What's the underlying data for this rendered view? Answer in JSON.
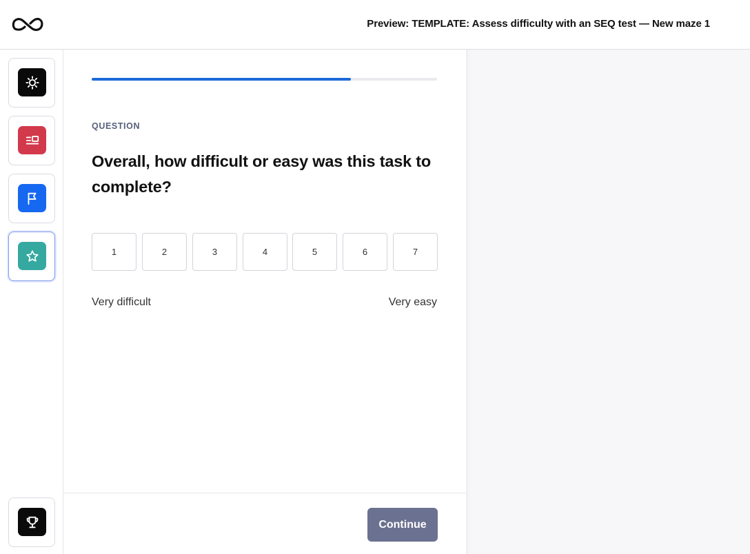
{
  "header": {
    "logo_icon": "maze-logo-icon",
    "title": "Preview: TEMPLATE: Assess difficulty with an SEQ test — New maze 1"
  },
  "sidebar": {
    "blocks": [
      {
        "icon": "gear-icon",
        "color": "#0a0a0a",
        "active": false
      },
      {
        "icon": "context-screen-icon",
        "color": "#d2394b",
        "active": false
      },
      {
        "icon": "flag-icon",
        "color": "#1668f0",
        "active": false
      },
      {
        "icon": "star-icon",
        "color": "#35a99f",
        "active": true
      }
    ],
    "thank_you_block": {
      "icon": "trophy-icon",
      "color": "#0a0a0a"
    }
  },
  "main": {
    "progress": 0.75,
    "progress_color": "#1b6ad9",
    "label": "QUESTION",
    "question": "Overall, how difficult or easy was this task to complete?",
    "scale_options": [
      "1",
      "2",
      "3",
      "4",
      "5",
      "6",
      "7"
    ],
    "scale_min_label": "Very difficult",
    "scale_max_label": "Very easy",
    "continue_label": "Continue",
    "continue_color": "#6b7190"
  }
}
